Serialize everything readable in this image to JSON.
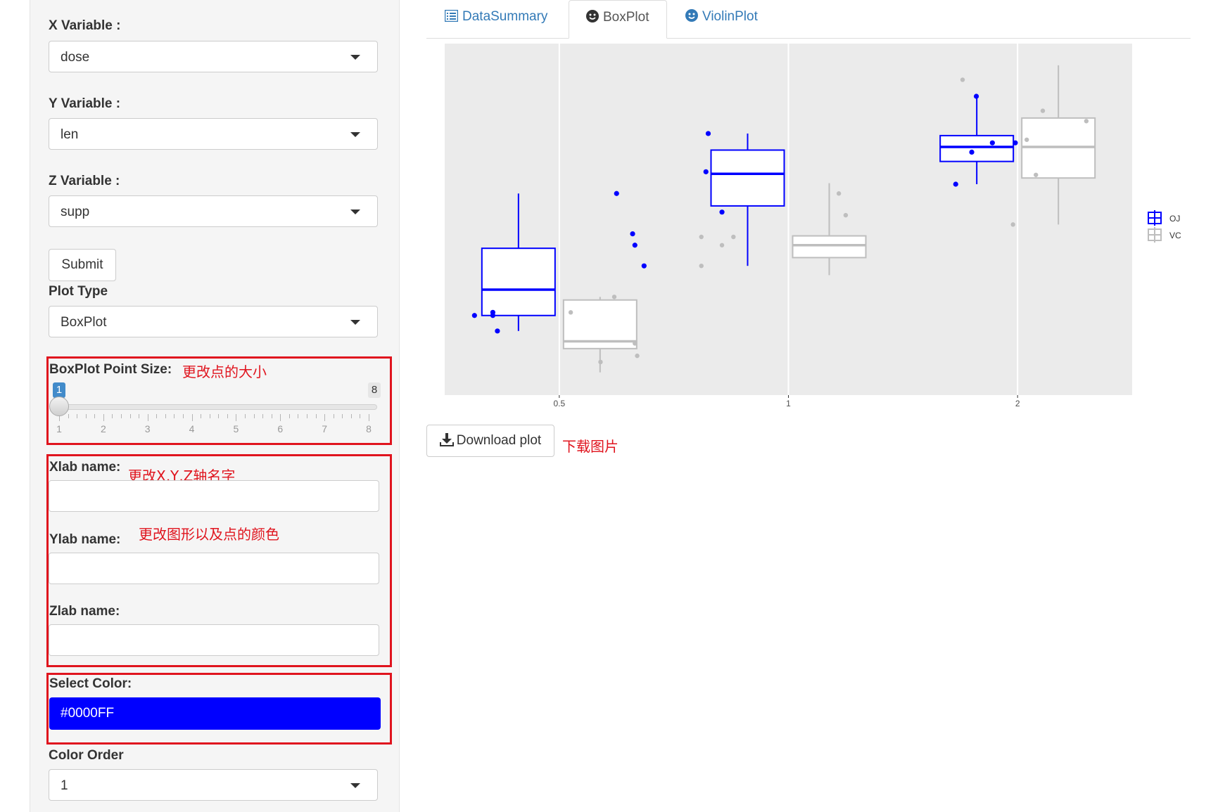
{
  "sidebar": {
    "x_variable": {
      "label": "X Variable :",
      "value": "dose"
    },
    "y_variable": {
      "label": "Y Variable :",
      "value": "len"
    },
    "z_variable": {
      "label": "Z Variable :",
      "value": "supp"
    },
    "submit_label": "Submit",
    "plot_type": {
      "label": "Plot Type",
      "value": "BoxPlot"
    },
    "point_size": {
      "label": "BoxPlot Point Size:",
      "min": "1",
      "max": "8",
      "current": "1",
      "tick_labels": [
        "1",
        "2",
        "3",
        "4",
        "5",
        "6",
        "7",
        "8"
      ]
    },
    "xlab": {
      "label": "Xlab name:",
      "value": ""
    },
    "ylab": {
      "label": "Ylab name:",
      "value": ""
    },
    "zlab": {
      "label": "Zlab name:",
      "value": ""
    },
    "select_color": {
      "label": "Select Color:",
      "value": "#0000FF"
    },
    "color_order": {
      "label": "Color Order",
      "value": "1"
    }
  },
  "annotations": {
    "point_size": "更改点的大小",
    "axis_names": "更改X,Y,Z轴名字",
    "colors": "更改图形以及点的颜色",
    "download": "下载图片"
  },
  "tabs": [
    {
      "label": "DataSummary",
      "icon": "list-icon"
    },
    {
      "label": "BoxPlot",
      "icon": "smile-icon",
      "active": true
    },
    {
      "label": "ViolinPlot",
      "icon": "smile-icon"
    }
  ],
  "download_label": "Download plot",
  "colors": {
    "accent": "#0000FF",
    "secondary": "#BEBEBE",
    "panel_bg": "#EBEBEB",
    "annotation_red": "#E0141E",
    "tab_blue": "#337AB7"
  },
  "chart_data": {
    "type": "box",
    "categories": [
      "0.5",
      "1",
      "2"
    ],
    "x_tick_labels": [
      "0.5",
      "1",
      "2"
    ],
    "y_axis_labels_shown": false,
    "ylim": [
      2,
      36
    ],
    "legend_position": "right",
    "series": [
      {
        "name": "OJ",
        "color": "#0000FF",
        "boxes": [
          {
            "category": "0.5",
            "min": 8.2,
            "q1": 9.7,
            "median": 12.2,
            "q3": 16.2,
            "max": 21.5
          },
          {
            "category": "1",
            "min": 14.5,
            "q1": 20.3,
            "median": 23.4,
            "q3": 25.7,
            "max": 27.3
          },
          {
            "category": "2",
            "min": 22.4,
            "q1": 24.6,
            "median": 26.0,
            "q3": 27.1,
            "max": 30.9
          }
        ],
        "points": [
          {
            "category": "0.5",
            "offset": 0.25,
            "y": 21.5
          },
          {
            "category": "0.5",
            "offset": 0.32,
            "y": 17.6
          },
          {
            "category": "0.5",
            "offset": 0.33,
            "y": 16.5
          },
          {
            "category": "0.5",
            "offset": 0.37,
            "y": 14.5
          },
          {
            "category": "0.5",
            "offset": -0.37,
            "y": 9.7
          },
          {
            "category": "0.5",
            "offset": -0.29,
            "y": 9.7
          },
          {
            "category": "0.5",
            "offset": -0.29,
            "y": 10.0
          },
          {
            "category": "0.5",
            "offset": -0.27,
            "y": 8.2
          },
          {
            "category": "1",
            "offset": -0.35,
            "y": 27.3
          },
          {
            "category": "1",
            "offset": -0.29,
            "y": 19.7
          },
          {
            "category": "1",
            "offset": -0.36,
            "y": 23.6
          },
          {
            "category": "2",
            "offset": -0.18,
            "y": 30.9
          },
          {
            "category": "2",
            "offset": -0.2,
            "y": 25.5
          },
          {
            "category": "2",
            "offset": -0.27,
            "y": 22.4
          },
          {
            "category": "2",
            "offset": -0.11,
            "y": 26.4
          },
          {
            "category": "2",
            "offset": -0.01,
            "y": 26.4
          }
        ]
      },
      {
        "name": "VC",
        "color": "#BEBEBE",
        "boxes": [
          {
            "category": "0.5",
            "min": 4.2,
            "q1": 6.5,
            "median": 7.2,
            "q3": 11.2,
            "max": 11.5
          },
          {
            "category": "1",
            "min": 13.6,
            "q1": 15.3,
            "median": 16.5,
            "q3": 17.4,
            "max": 22.5
          },
          {
            "category": "2",
            "min": 18.5,
            "q1": 23.0,
            "median": 26.0,
            "q3": 28.8,
            "max": 33.9
          }
        ],
        "points": [
          {
            "category": "0.5",
            "offset": 0.18,
            "y": 5.2
          },
          {
            "category": "0.5",
            "offset": 0.24,
            "y": 11.5
          },
          {
            "category": "0.5",
            "offset": 0.33,
            "y": 7.0
          },
          {
            "category": "0.5",
            "offset": 0.34,
            "y": 5.8
          },
          {
            "category": "0.5",
            "offset": 0.05,
            "y": 10.0
          },
          {
            "category": "1",
            "offset": -0.38,
            "y": 17.3
          },
          {
            "category": "1",
            "offset": -0.29,
            "y": 16.5
          },
          {
            "category": "1",
            "offset": -0.24,
            "y": 17.3
          },
          {
            "category": "1",
            "offset": -0.38,
            "y": 14.5
          },
          {
            "category": "1",
            "offset": 0.22,
            "y": 21.5
          },
          {
            "category": "1",
            "offset": 0.25,
            "y": 19.4
          },
          {
            "category": "2",
            "offset": -0.24,
            "y": 32.5
          },
          {
            "category": "2",
            "offset": 0.11,
            "y": 29.5
          },
          {
            "category": "2",
            "offset": 0.3,
            "y": 28.5
          },
          {
            "category": "2",
            "offset": -0.02,
            "y": 18.5
          },
          {
            "category": "2",
            "offset": 0.08,
            "y": 23.3
          },
          {
            "category": "2",
            "offset": 0.04,
            "y": 26.7
          }
        ]
      }
    ]
  }
}
